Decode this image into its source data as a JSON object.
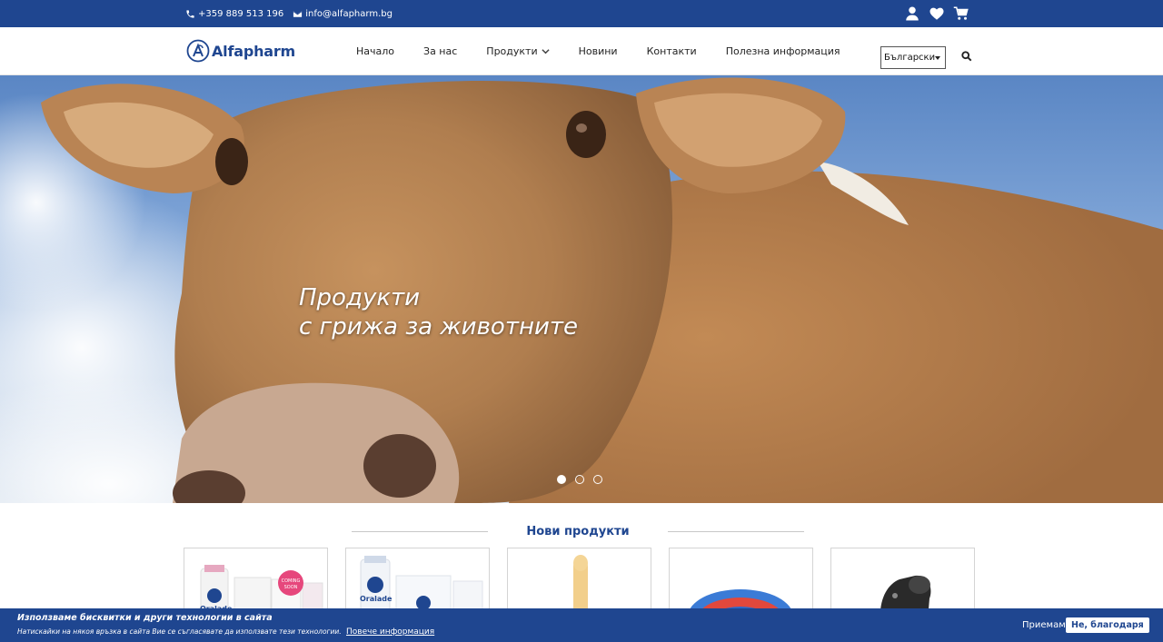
{
  "topbar": {
    "phone": "+359 889 513 196",
    "email": "info@alfapharm.bg",
    "icons": [
      "phone-icon",
      "envelope-icon",
      "user-icon",
      "heart-icon",
      "cart-icon"
    ]
  },
  "header": {
    "logo_text": "Alfapharm",
    "nav": [
      {
        "label": "Начало"
      },
      {
        "label": "За нас"
      },
      {
        "label": "Продукти"
      },
      {
        "label": "Новини"
      },
      {
        "label": "Контакти"
      },
      {
        "label": "Полезна информация"
      }
    ],
    "language": "Български"
  },
  "hero": {
    "line1": "Продукти",
    "line2": "с грижа за животните",
    "slides_count": 3,
    "active_slide": 1
  },
  "new_products": {
    "title": "Нови продукти",
    "cards": [
      {
        "name": "Oralade",
        "badge_line1": "COMING",
        "badge_line2": "SOON"
      },
      {
        "name": "Oralade"
      },
      {
        "name": ""
      },
      {
        "name": ""
      },
      {
        "name": ""
      }
    ]
  },
  "cookie": {
    "title": "Използваме бисквитки и други технологии в сайта",
    "text": "Натискайки на някоя връзка в сайта Вие се съгласявате да използвате тези технологии.",
    "more_link": "Повече информация",
    "accept": "Приемам",
    "decline": "Не, благодаря"
  },
  "colors": {
    "brand_blue": "#1f4690",
    "white": "#ffffff"
  }
}
